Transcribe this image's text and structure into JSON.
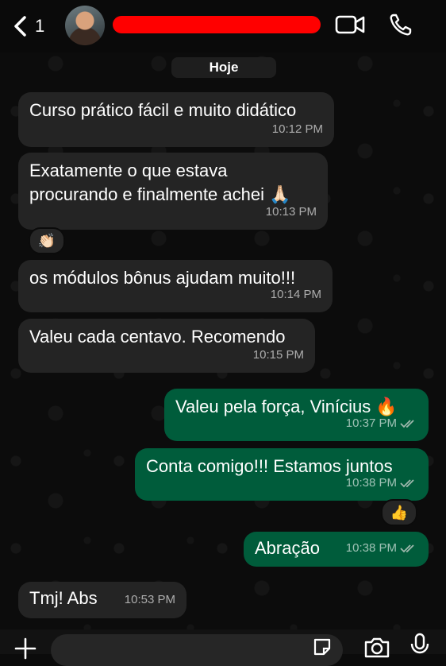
{
  "header": {
    "back_count": "1",
    "contact_name_redacted": true
  },
  "date_chip": "Hoje",
  "messages": [
    {
      "dir": "in",
      "text": [
        "Curso prático fácil e muito didático"
      ],
      "time": "10:12 PM"
    },
    {
      "dir": "in",
      "text": [
        "Exatamente o que estava",
        "procurando e finalmente achei 🙏🏻"
      ],
      "time": "10:13 PM",
      "reaction": "👏🏻"
    },
    {
      "dir": "in",
      "text": [
        "os módulos bônus ajudam muito!!!"
      ],
      "time": "10:14 PM"
    },
    {
      "dir": "in",
      "text": [
        "Valeu cada centavo. Recomendo"
      ],
      "time": "10:15 PM"
    },
    {
      "dir": "out",
      "text": [
        "Valeu pela força, Vinícius 🔥"
      ],
      "time": "10:37 PM",
      "read": true
    },
    {
      "dir": "out",
      "text": [
        "Conta comigo!!! Estamos juntos"
      ],
      "time": "10:38 PM",
      "read": true,
      "reaction": "👍"
    },
    {
      "dir": "out",
      "text": [
        "Abração"
      ],
      "time": "10:38 PM",
      "read": true
    },
    {
      "dir": "in",
      "text": [
        "Tmj! Abs"
      ],
      "time": "10:53 PM"
    }
  ],
  "colors": {
    "incoming_bubble": "#242424",
    "outgoing_bubble": "#005c3b",
    "read_ticks": "#9fb8ad",
    "redaction": "#ff0000"
  },
  "icons": [
    "chevron-left-icon",
    "video-call-icon",
    "phone-icon",
    "plus-icon",
    "sticker-icon",
    "camera-icon",
    "microphone-icon"
  ]
}
